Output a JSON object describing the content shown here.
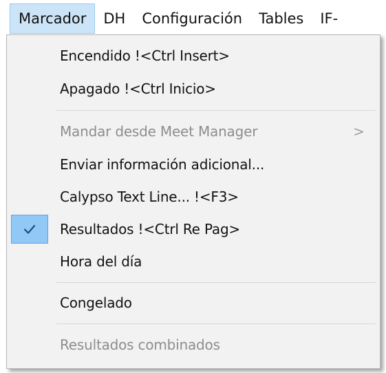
{
  "menubar": {
    "items": [
      {
        "label": "Marcador"
      },
      {
        "label": "DH"
      },
      {
        "label": "Configuración"
      },
      {
        "label": "Tables"
      },
      {
        "label": "IF-"
      }
    ]
  },
  "dropdown": {
    "items": [
      {
        "label": "Encendido  !<Ctrl Insert>"
      },
      {
        "label": "Apagado  !<Ctrl Inicio>"
      },
      {
        "label": "Mandar desde Meet Manager",
        "arrow": ">"
      },
      {
        "label": "Enviar información adicional..."
      },
      {
        "label": "Calypso Text Line...  !<F3>"
      },
      {
        "label": "Resultados  !<Ctrl Re Pag>"
      },
      {
        "label": "Hora del día"
      },
      {
        "label": "Congelado"
      },
      {
        "label": "Resultados combinados"
      }
    ]
  },
  "colors": {
    "active_menu_bg": "#cce4f7",
    "check_bg": "#90c8f6",
    "menu_bg": "#f2f2f2",
    "disabled_text": "#8d8d8d"
  },
  "icons": {
    "check": "checkmark-icon",
    "submenu": "chevron-right-icon"
  }
}
